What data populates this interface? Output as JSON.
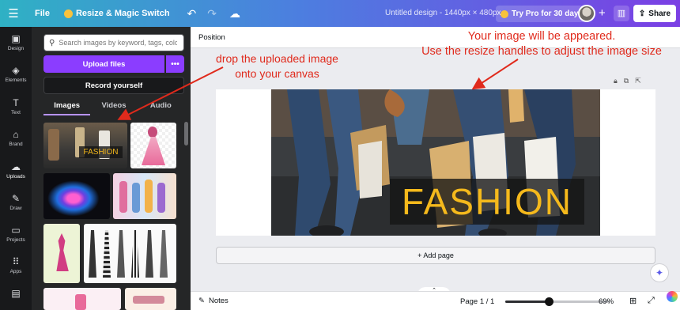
{
  "topbar": {
    "file_label": "File",
    "resize_label": "Resize & Magic Switch",
    "doc_title": "Untitled design - 1440px × 480px",
    "try_pro_label": "Try Pro for 30 days",
    "share_label": "Share"
  },
  "rail": {
    "items": [
      {
        "label": "Design",
        "icon": "design-icon"
      },
      {
        "label": "Elements",
        "icon": "elements-icon"
      },
      {
        "label": "Text",
        "icon": "text-icon"
      },
      {
        "label": "Brand",
        "icon": "brand-icon"
      },
      {
        "label": "Uploads",
        "icon": "uploads-icon"
      },
      {
        "label": "Draw",
        "icon": "draw-icon"
      },
      {
        "label": "Projects",
        "icon": "projects-icon"
      },
      {
        "label": "Apps",
        "icon": "apps-icon"
      }
    ],
    "active": "Uploads"
  },
  "panel": {
    "search_placeholder": "Search images by keyword, tags, color...",
    "upload_label": "Upload files",
    "upload_more_label": "•••",
    "record_label": "Record yourself",
    "tabs": [
      "Images",
      "Videos",
      "Audio"
    ],
    "active_tab": "Images",
    "thumb_fashion_text": "FASHION"
  },
  "workspace": {
    "position_label": "Position",
    "add_page_label": "+ Add page",
    "canvas_fashion_text": "FASHION"
  },
  "annotations": {
    "right_line1": "Your image will be appeared.",
    "right_line2": "Use the resize handles to adjust the image size",
    "left_line1": "drop the uploaded image",
    "left_line2": "onto your canvas"
  },
  "bottombar": {
    "notes_label": "Notes",
    "page_label": "Page 1 / 1",
    "zoom_label": "69%",
    "zoom_fraction": 0.69
  },
  "colors": {
    "accent": "#8b3dff",
    "annotation": "#e02a1c",
    "fashion_text": "#f5b91c"
  }
}
